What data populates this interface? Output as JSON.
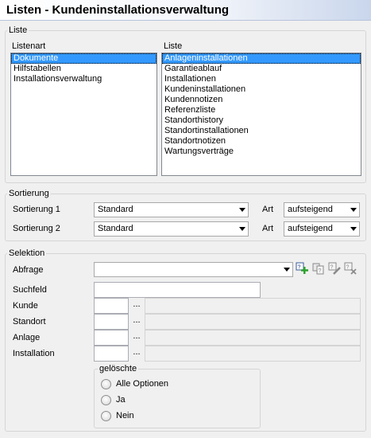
{
  "window": {
    "title": "Listen - Kundeninstallationsverwaltung"
  },
  "liste": {
    "legend": "Liste",
    "listenart_label": "Listenart",
    "listenart_items": [
      "Dokumente",
      "Hilfstabellen",
      "Installationsverwaltung"
    ],
    "listenart_selected": 0,
    "liste_label": "Liste",
    "liste_items": [
      "Anlageninstallationen",
      "Garantieablauf",
      "Installationen",
      "Kundeninstallationen",
      "Kundennotizen",
      "Referenzliste",
      "Standorthistory",
      "Standortinstallationen",
      "Standortnotizen",
      "Wartungsverträge"
    ],
    "liste_selected": 0
  },
  "sortierung": {
    "legend": "Sortierung",
    "rows": [
      {
        "label": "Sortierung 1",
        "field_value": "Standard",
        "art_label": "Art",
        "art_value": "aufsteigend"
      },
      {
        "label": "Sortierung 2",
        "field_value": "Standard",
        "art_label": "Art",
        "art_value": "aufsteigend"
      }
    ]
  },
  "selektion": {
    "legend": "Selektion",
    "abfrage_label": "Abfrage",
    "abfrage_value": "",
    "abfrage_icons": [
      "new-query-icon",
      "copy-query-icon",
      "edit-query-icon",
      "delete-query-icon"
    ],
    "suchfeld_label": "Suchfeld",
    "suchfeld_value": "",
    "lookups": [
      {
        "label": "Kunde",
        "button": "..."
      },
      {
        "label": "Standort",
        "button": "..."
      },
      {
        "label": "Anlage",
        "button": "..."
      },
      {
        "label": "Installation",
        "button": "..."
      }
    ],
    "geloeschte": {
      "legend": "gelöschte",
      "options": [
        "Alle Optionen",
        "Ja",
        "Nein"
      ]
    }
  }
}
